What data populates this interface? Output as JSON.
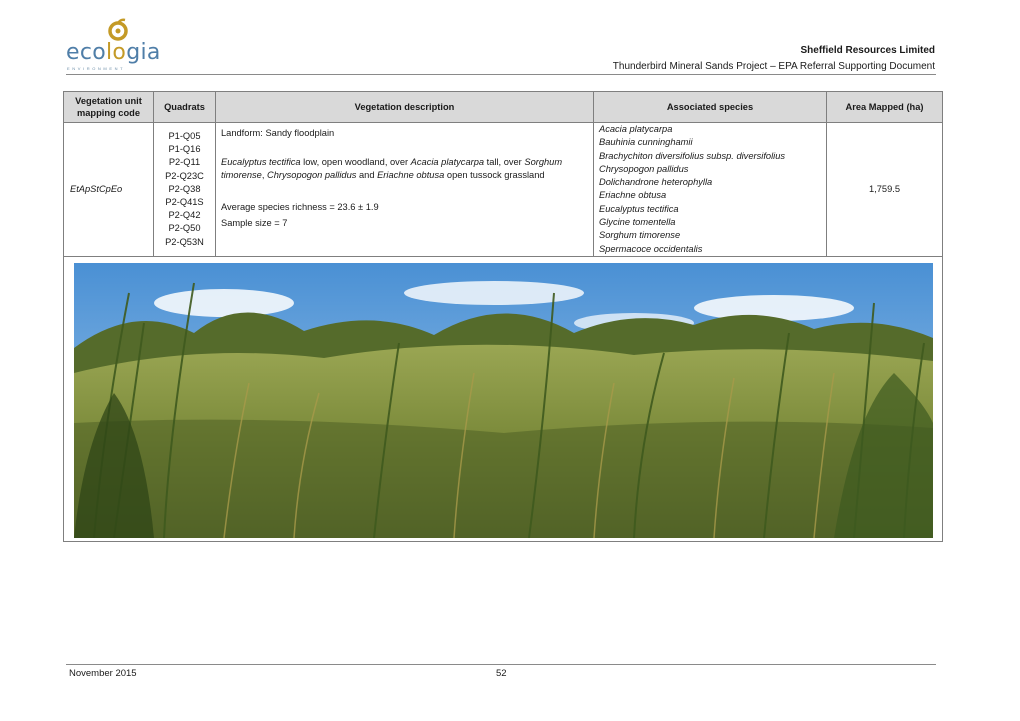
{
  "header": {
    "logo": {
      "text_prefix": "eco",
      "text_accent": "lo",
      "text_suffix": "gia",
      "tagline": "ENVIRONMENT"
    },
    "company": "Sheffield Resources Limited",
    "document_title": "Thunderbird Mineral Sands Project – EPA Referral Supporting Document"
  },
  "table": {
    "headers": {
      "code": "Vegetation unit mapping code",
      "quadrats": "Quadrats",
      "description": "Vegetation description",
      "species": "Associated species",
      "area": "Area Mapped (ha)"
    },
    "row": {
      "code": "EtApStCpEo",
      "quadrats": [
        "P1-Q05",
        "P1-Q16",
        "P2-Q11",
        "P2-Q23C",
        "P2-Q38",
        "P2-Q41S",
        "P2-Q42",
        "P2-Q50",
        "P2-Q53N"
      ],
      "landform": "Landform: Sandy floodplain",
      "description": {
        "t1": "Eucalyptus tectifica",
        "t2": " low, open woodland, over ",
        "t3": "Acacia platycarpa",
        "t4": " tall, over ",
        "t5": "Sorghum timorense",
        "t6": ", ",
        "t7": "Chrysopogon pallidus",
        "t8": " and ",
        "t9": "Eriachne obtusa",
        "t10": " open tussock grassland"
      },
      "richness": "Average species richness = 23.6 ± 1.9",
      "sample_size": "Sample size = 7",
      "species": [
        "Acacia platycarpa",
        "Bauhinia cunninghamii",
        "Brachychiton diversifolius subsp. diversifolius",
        "Chrysopogon pallidus",
        "Dolichandrone heterophylla",
        "Eriachne obtusa",
        "Eucalyptus tectifica",
        "Glycine tomentella",
        "Sorghum timorense",
        "Spermacoce occidentalis"
      ],
      "area": "1,759.5"
    }
  },
  "colors": {
    "header_fill": "#d9d9d9",
    "logo_blue": "#4f7ea8",
    "logo_gold": "#c49a26"
  },
  "footer": {
    "date": "November 2015",
    "page": "52"
  }
}
